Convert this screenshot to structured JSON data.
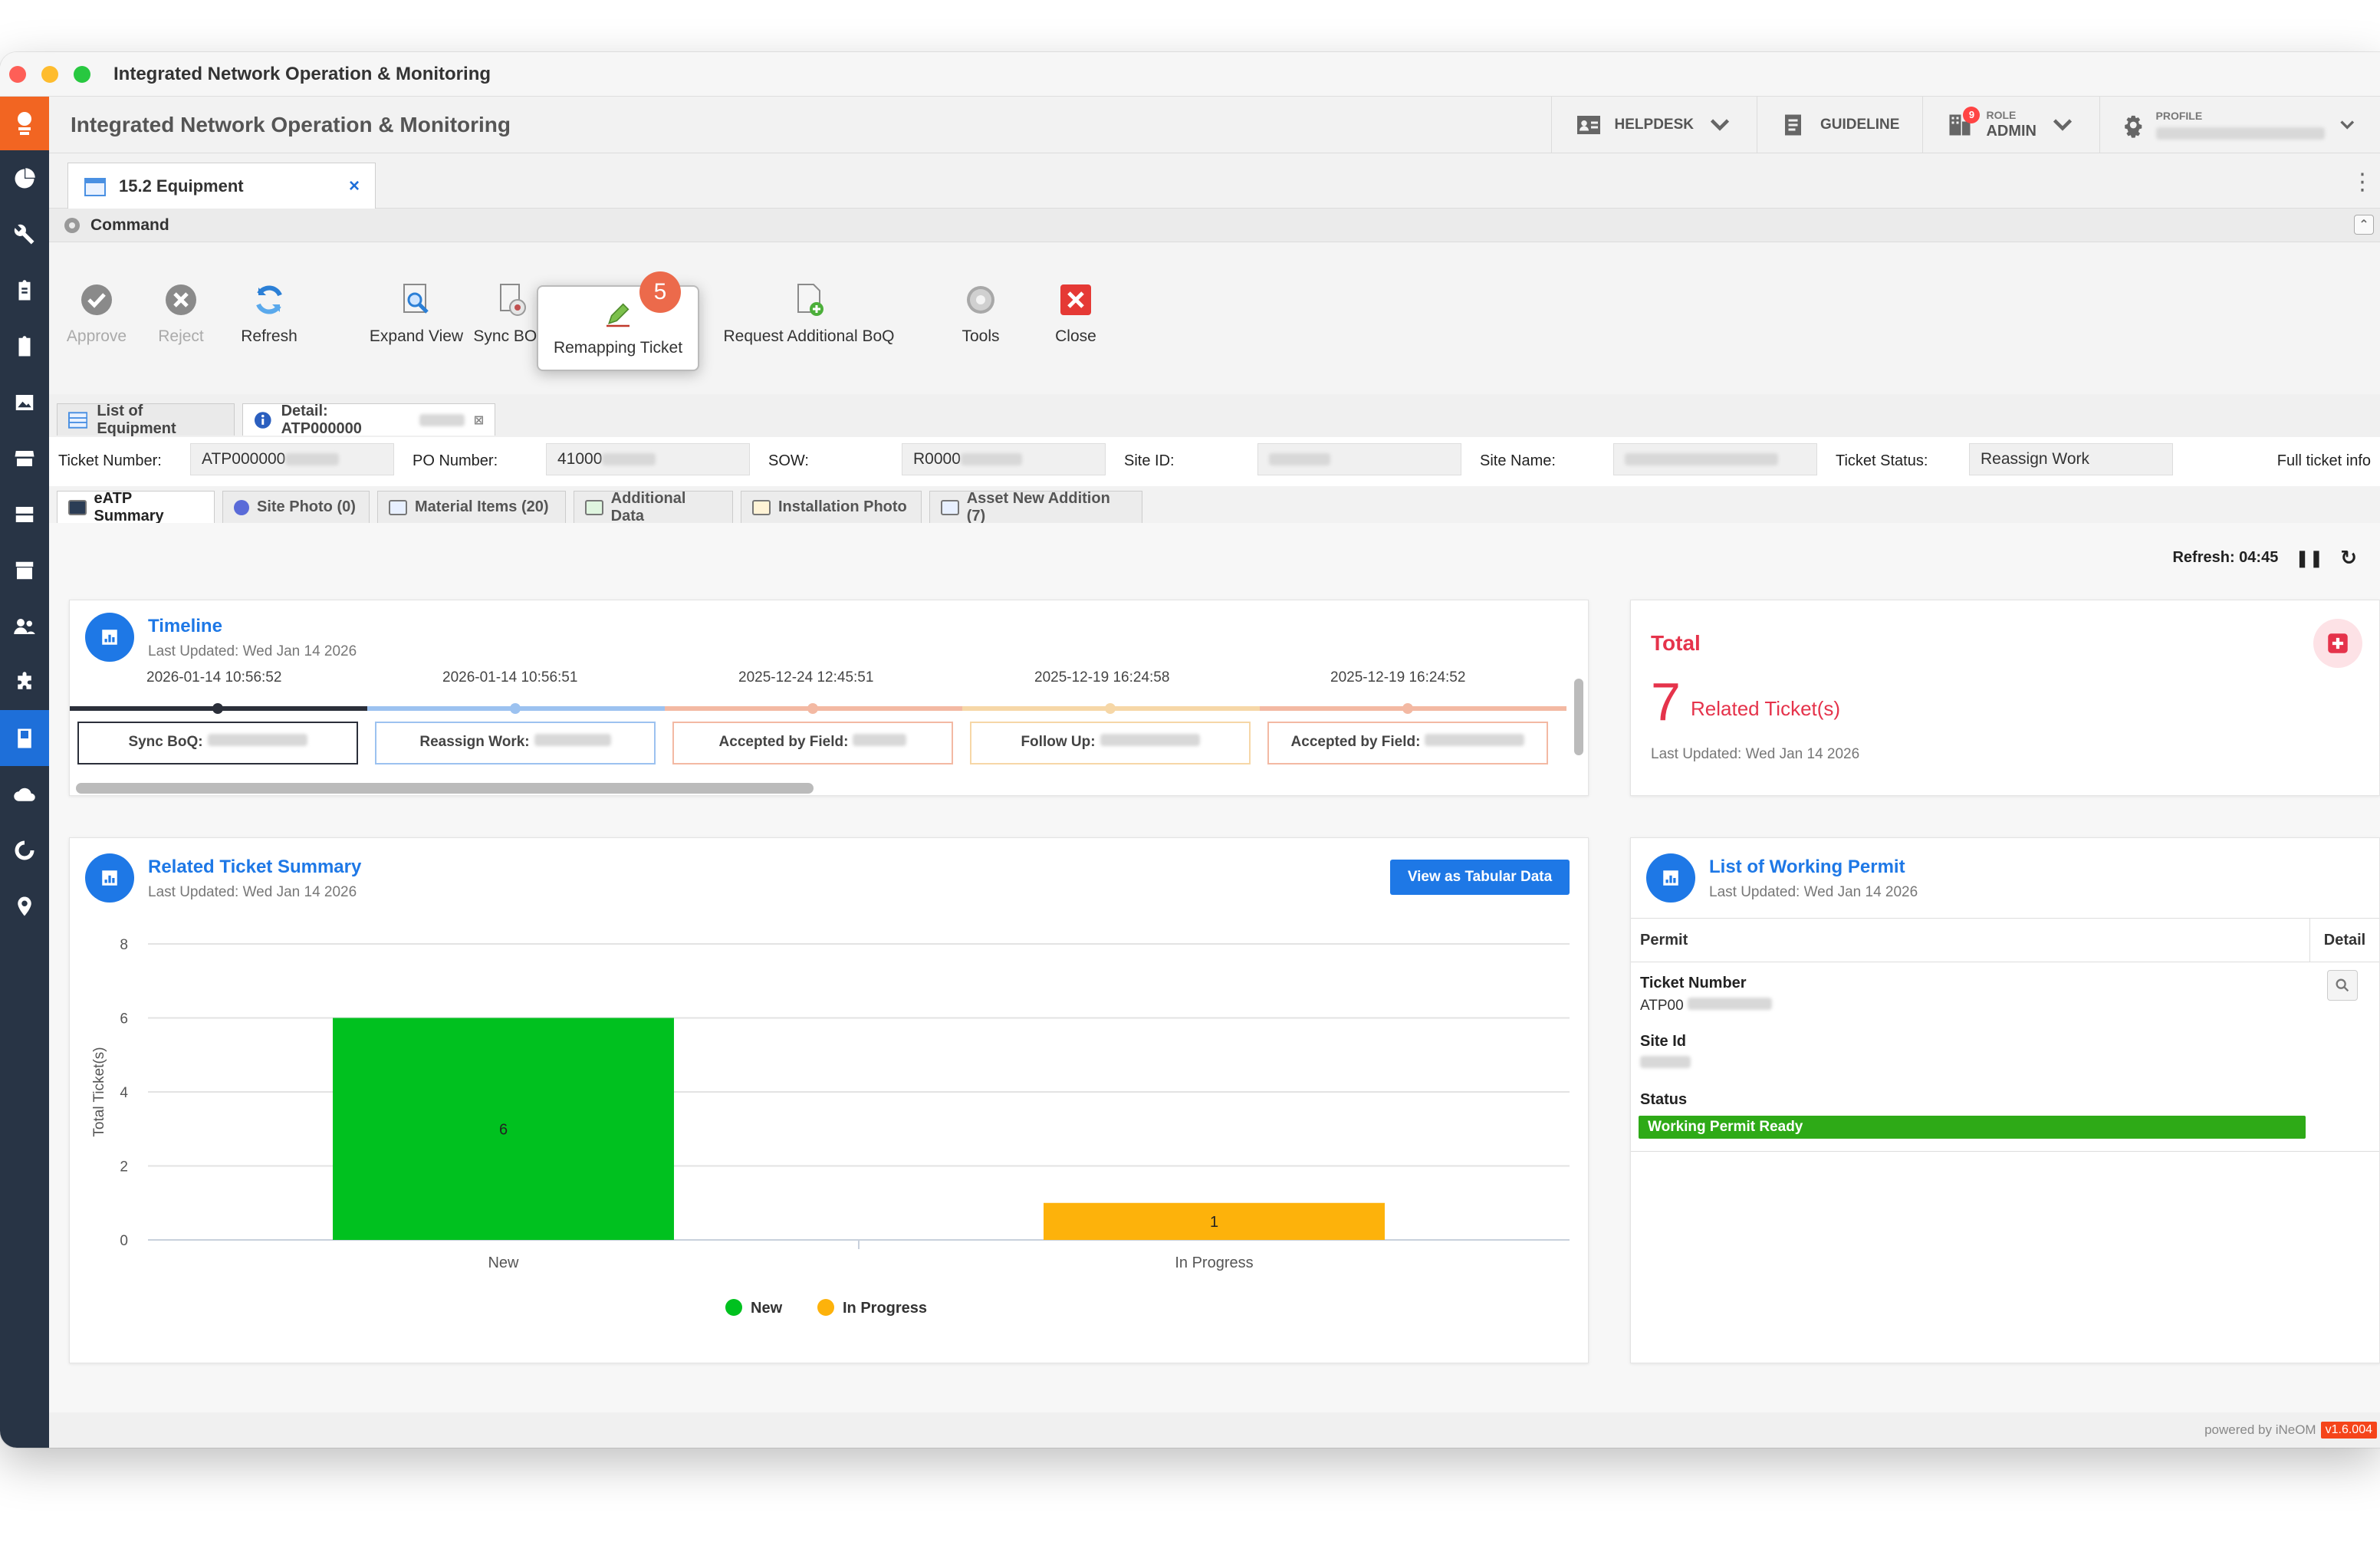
{
  "window": {
    "title": "Integrated Network Operation & Monitoring"
  },
  "header": {
    "app_title": "Integrated Network Operation & Monitoring",
    "helpdesk": "HELPDESK",
    "guideline": "GUIDELINE",
    "role_caption": "ROLE",
    "role_value": "ADMIN",
    "role_badge": "9",
    "profile_caption": "PROFILE"
  },
  "page_tab": {
    "label": "15.2 Equipment",
    "close": "×"
  },
  "command": {
    "title": "Command",
    "tools": [
      {
        "label": "Approve",
        "icon": "check-circle-icon",
        "enabled": false
      },
      {
        "label": "Reject",
        "icon": "x-circle-icon",
        "enabled": false
      },
      {
        "label": "Refresh",
        "icon": "refresh-icon",
        "enabled": true
      },
      {
        "label": "Expand View",
        "icon": "expand-view-icon",
        "enabled": true
      },
      {
        "label": "Sync BOQ",
        "icon": "sync-boq-icon",
        "enabled": true
      },
      {
        "label": "Remapping Ticket",
        "icon": "edit-pencil-icon",
        "enabled": true
      },
      {
        "label": "Request Additional BoQ",
        "icon": "add-document-icon",
        "enabled": true
      },
      {
        "label": "Tools",
        "icon": "gear-icon",
        "enabled": true
      },
      {
        "label": "Close",
        "icon": "close-red-icon",
        "enabled": true
      }
    ],
    "step_badge": "5"
  },
  "subtabs": [
    {
      "label": "List of Equipment"
    },
    {
      "label": "Detail: ATP000000"
    }
  ],
  "info": {
    "ticket_number_label": "Ticket Number:",
    "ticket_number_value": "ATP000000",
    "po_number_label": "PO Number:",
    "po_number_value": "41000",
    "sow_label": "SOW:",
    "sow_value": "R0000",
    "site_id_label": "Site ID:",
    "site_name_label": "Site Name:",
    "ticket_status_label": "Ticket Status:",
    "ticket_status_value": "Reassign Work",
    "full_info": "Full ticket info"
  },
  "content_tabs": [
    {
      "label": "eATP Summary"
    },
    {
      "label": "Site Photo (0)"
    },
    {
      "label": "Material Items (20)"
    },
    {
      "label": "Additional Data"
    },
    {
      "label": "Installation Photo"
    },
    {
      "label": "Asset New Addition (7)"
    }
  ],
  "refresh": {
    "label": "Refresh: 04:45"
  },
  "timeline": {
    "title": "Timeline",
    "updated": "Last Updated: Wed Jan 14 2026",
    "events": [
      {
        "date": "2026-01-14 10:56:52",
        "label": "Sync BoQ:",
        "color": "#2b2f3a"
      },
      {
        "date": "2026-01-14 10:56:51",
        "label": "Reassign Work:",
        "color": "#9cc2f0"
      },
      {
        "date": "2025-12-24 12:45:51",
        "label": "Accepted by Field:",
        "color": "#f3b9a3"
      },
      {
        "date": "2025-12-19 16:24:58",
        "label": "Follow Up:",
        "color": "#f6d7a7"
      },
      {
        "date": "2025-12-19 16:24:52",
        "label": "Accepted by Field:",
        "color": "#f3b9a3"
      }
    ]
  },
  "total": {
    "title": "Total",
    "count": "7",
    "caption": "Related Ticket(s)",
    "updated": "Last Updated: Wed Jan 14 2026"
  },
  "summary": {
    "title": "Related Ticket Summary",
    "updated": "Last Updated: Wed Jan 14 2026",
    "button": "View as Tabular Data"
  },
  "chart_data": {
    "type": "bar",
    "categories": [
      "New",
      "In Progress"
    ],
    "values": [
      6,
      1
    ],
    "colors": [
      "#00c11f",
      "#fdb20b"
    ],
    "ylabel": "Total Ticket(s)",
    "ylim": [
      0,
      8
    ],
    "yticks": [
      "0",
      "2",
      "4",
      "6",
      "8"
    ],
    "legend": [
      "New",
      "In Progress"
    ],
    "legend_position": "bottom",
    "grid": true,
    "data_labels": [
      "6",
      "1"
    ]
  },
  "permit": {
    "title": "List of Working Permit",
    "updated": "Last Updated: Wed Jan 14 2026",
    "col_permit": "Permit",
    "col_detail": "Detail",
    "ticket_number_label": "Ticket Number",
    "ticket_number_value": "ATP00",
    "site_id_label": "Site Id",
    "status_label": "Status",
    "status_value": "Working Permit Ready"
  },
  "footer": {
    "powered": "powered by iNeOM",
    "version": "v1.6.004"
  }
}
